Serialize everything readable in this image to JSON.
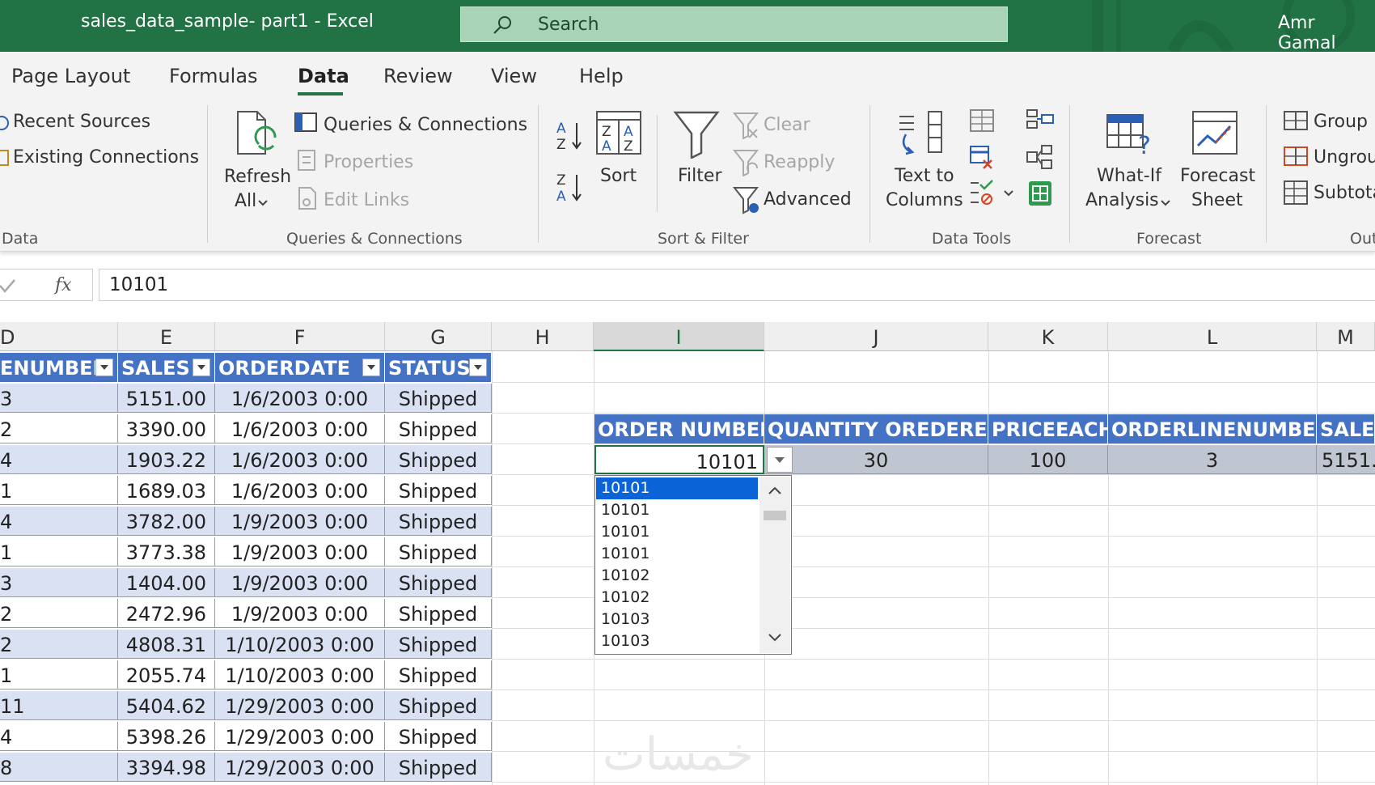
{
  "window": {
    "title": "sales_data_sample- part1  -  Excel",
    "search_placeholder": "Search",
    "user": "Amr Gamal"
  },
  "tabs": [
    {
      "label": "Page Layout"
    },
    {
      "label": "Formulas"
    },
    {
      "label": "Data",
      "active": true
    },
    {
      "label": "Review"
    },
    {
      "label": "View"
    },
    {
      "label": "Help"
    }
  ],
  "ribbon": {
    "get_data": {
      "recent_sources": "Recent Sources",
      "existing_connections": "Existing Connections",
      "group_label": "Data"
    },
    "queries": {
      "refresh_line1": "Refresh",
      "refresh_line2": "All",
      "queries_connections": "Queries & Connections",
      "properties": "Properties",
      "edit_links": "Edit Links",
      "group_label": "Queries & Connections"
    },
    "sort_filter": {
      "sort": "Sort",
      "filter": "Filter",
      "clear": "Clear",
      "reapply": "Reapply",
      "advanced": "Advanced",
      "group_label": "Sort & Filter"
    },
    "data_tools": {
      "text_to_line1": "Text to",
      "text_to_line2": "Columns",
      "group_label": "Data Tools"
    },
    "forecast": {
      "whatif_line1": "What-If",
      "whatif_line2": "Analysis",
      "sheet_line1": "Forecast",
      "sheet_line2": "Sheet",
      "group_label": "Forecast"
    },
    "outline": {
      "group": "Group",
      "ungroup": "Ungrou",
      "subtotal": "Subtota",
      "group_label": "Outlin"
    }
  },
  "formula_bar": {
    "value": "10101"
  },
  "columns": [
    "D",
    "E",
    "F",
    "G",
    "H",
    "I",
    "J",
    "K",
    "L",
    "M"
  ],
  "left_table": {
    "headers": [
      "ENUMBER",
      "SALES",
      "ORDERDATE",
      "STATUS"
    ],
    "rows": [
      [
        "3",
        "5151.00",
        "1/6/2003 0:00",
        "Shipped"
      ],
      [
        "2",
        "3390.00",
        "1/6/2003 0:00",
        "Shipped"
      ],
      [
        "4",
        "1903.22",
        "1/6/2003 0:00",
        "Shipped"
      ],
      [
        "1",
        "1689.03",
        "1/6/2003 0:00",
        "Shipped"
      ],
      [
        "4",
        "3782.00",
        "1/9/2003 0:00",
        "Shipped"
      ],
      [
        "1",
        "3773.38",
        "1/9/2003 0:00",
        "Shipped"
      ],
      [
        "3",
        "1404.00",
        "1/9/2003 0:00",
        "Shipped"
      ],
      [
        "2",
        "2472.96",
        "1/9/2003 0:00",
        "Shipped"
      ],
      [
        "2",
        "4808.31",
        "1/10/2003 0:00",
        "Shipped"
      ],
      [
        "1",
        "2055.74",
        "1/10/2003 0:00",
        "Shipped"
      ],
      [
        "11",
        "5404.62",
        "1/29/2003 0:00",
        "Shipped"
      ],
      [
        "4",
        "5398.26",
        "1/29/2003 0:00",
        "Shipped"
      ],
      [
        "8",
        "3394.98",
        "1/29/2003 0:00",
        "Shipped"
      ]
    ]
  },
  "lookup_table": {
    "headers": [
      "ORDER NUMBER",
      "QUANTITY OREDERED",
      "PRICEEACH",
      "ORDERLINENUMBER",
      "SALE"
    ],
    "row": [
      "10101",
      "30",
      "100",
      "3",
      "5151."
    ]
  },
  "dropdown": {
    "items": [
      "10101",
      "10101",
      "10101",
      "10101",
      "10102",
      "10102",
      "10103",
      "10103"
    ],
    "selected_index": 0
  },
  "watermark": "خمسات",
  "colors": {
    "excel_green": "#217346",
    "table_header": "#4472c4",
    "band": "#d9e1f2"
  }
}
